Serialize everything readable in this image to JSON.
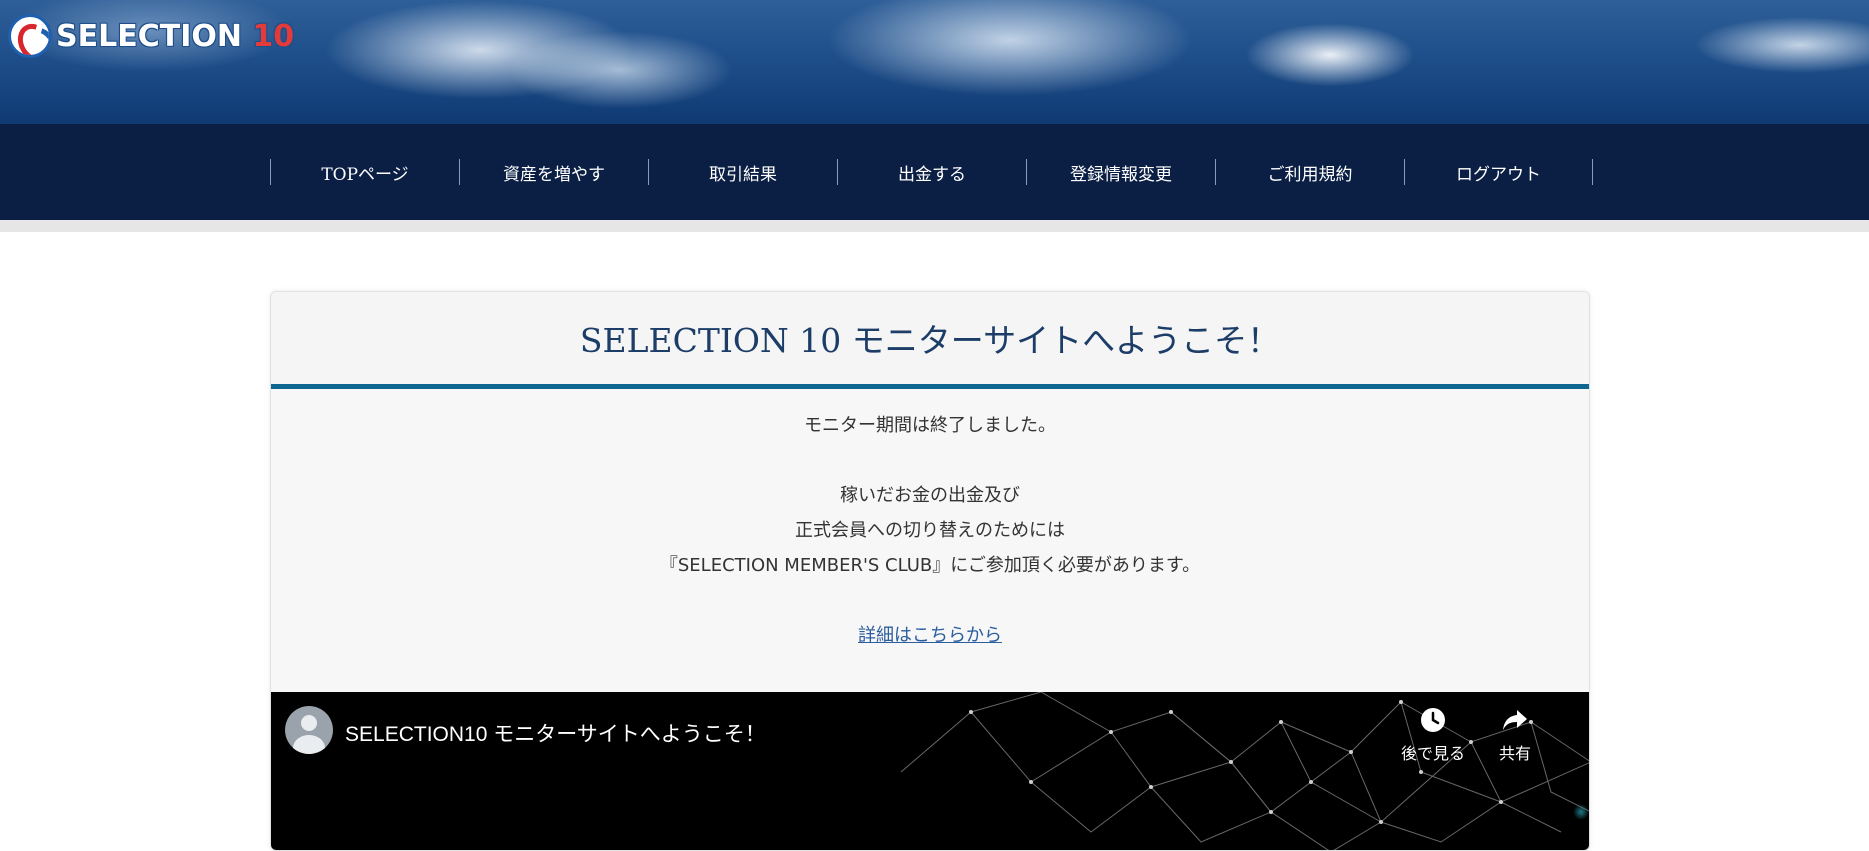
{
  "header": {
    "logo_text": "SELECTION",
    "logo_number": "10"
  },
  "nav": {
    "items": [
      {
        "label": "TOPページ"
      },
      {
        "label": "資産を増やす"
      },
      {
        "label": "取引結果"
      },
      {
        "label": "出金する"
      },
      {
        "label": "登録情報変更"
      },
      {
        "label": "ご利用規約"
      },
      {
        "label": "ログアウト"
      }
    ]
  },
  "card": {
    "title": "SELECTION 10 モニターサイトへようこそ！",
    "line1": "モニター期間は終了しました。",
    "line2": "稼いだお金の出金及び",
    "line3": "正式会員への切り替えのためには",
    "line4": "『SELECTION MEMBER'S CLUB』にご参加頂く必要があります。",
    "link": "詳細はこちらから"
  },
  "video": {
    "title": "SELECTION10 モニターサイトへようこそ！",
    "watch_later_label": "後で見る",
    "watch_later_icon": "clock-icon",
    "share_label": "共有",
    "share_icon": "share-arrow-icon"
  },
  "colors": {
    "nav_bg": "#0b1f45",
    "title_color": "#1c3d68",
    "rule_color": "#0f6690",
    "link_color": "#2b5e9e"
  }
}
